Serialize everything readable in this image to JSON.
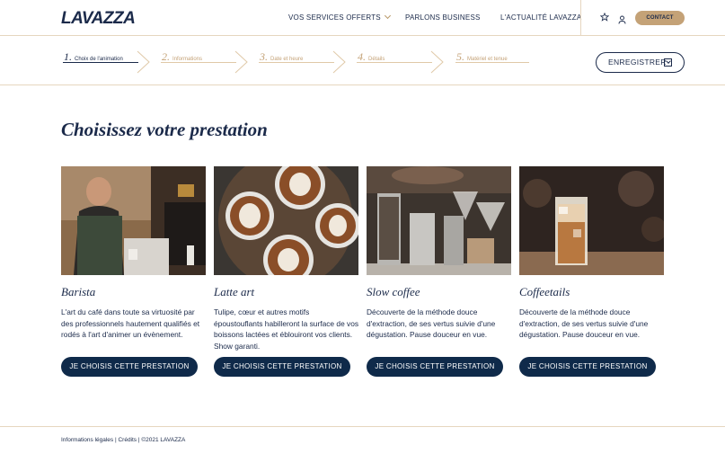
{
  "header": {
    "logo": "LAVAZZA",
    "nav": [
      {
        "label": "VOS SERVICES OFFERTS",
        "has_dropdown": true
      },
      {
        "label": "PARLONS BUSINESS"
      },
      {
        "label": "L'ACTUALITÉ LAVAZZA"
      }
    ],
    "icons": [
      "star-icon",
      "user-icon"
    ],
    "contact_label": "CONTACT"
  },
  "steps": [
    {
      "num": "1.",
      "label": "Choix de l'animation",
      "active": true
    },
    {
      "num": "2.",
      "label": "Informations",
      "active": false
    },
    {
      "num": "3.",
      "label": "Date et heure",
      "active": false
    },
    {
      "num": "4.",
      "label": "Détails",
      "active": false
    },
    {
      "num": "5.",
      "label": "Matériel et tenue",
      "active": false
    }
  ],
  "save_label": "ENREGISTRER",
  "main": {
    "title": "Choisissez votre prestation",
    "cards": [
      {
        "title": "Barista",
        "desc": "L'art du café dans toute sa virtuosité par des professionnels hautement qualifiés et rodés à l'art d'animer un évènement.",
        "button": "JE CHOISIS CETTE PRESTATION"
      },
      {
        "title": "Latte art",
        "desc": "Tulipe, cœur et autres motifs époustouflants habilleront la surface de vos boissons lactées et éblouiront vos clients. Show garanti.",
        "button": "JE CHOISIS CETTE PRESTATION"
      },
      {
        "title": "Slow coffee",
        "desc": "Découverte de la méthode douce d'extraction, de ses vertus suivie d'une dégustation. Pause douceur en vue.",
        "button": "JE CHOISIS CETTE PRESTATION"
      },
      {
        "title": "Coffeetails",
        "desc": "Découverte de la méthode douce d'extraction, de ses vertus suivie d'une dégustation. Pause douceur en vue.",
        "button": "JE CHOISIS CETTE PRESTATION"
      }
    ]
  },
  "footer": {
    "text": "Informations légales |  Crédits | ©2021  LAVAZZA"
  },
  "colors": {
    "navy": "#1b2a4a",
    "button_navy": "#0f2a4a",
    "gold": "#c4a277",
    "divider": "#e6d6bf"
  }
}
